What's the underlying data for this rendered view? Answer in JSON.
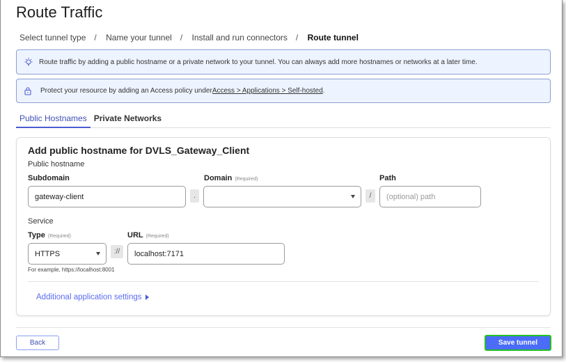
{
  "page": {
    "title": "Route Traffic"
  },
  "breadcrumb": [
    "Select tunnel type",
    "Name your tunnel",
    "Install and run connectors",
    "Route tunnel"
  ],
  "notices": {
    "tip": {
      "icon": "lightbulb-icon",
      "text": "Route traffic by adding a public hostname or a private network to your tunnel. You can always add more hostnames or networks at a later time."
    },
    "access": {
      "icon": "lock-icon",
      "text": "Protect your resource by adding an Access policy under ",
      "link": "Access > Applications > Self-hosted",
      "suffix": "."
    }
  },
  "tabs": [
    {
      "label": "Public Hostnames",
      "active": true
    },
    {
      "label": "Private Networks",
      "active": false
    }
  ],
  "form": {
    "title": "Add public hostname for DVLS_Gateway_Client",
    "public_hostname_label": "Public hostname",
    "subdomain": {
      "label": "Subdomain",
      "value": "gateway-client"
    },
    "dot": ".",
    "domain": {
      "label": "Domain",
      "required": "(Required)",
      "value": ""
    },
    "slash": "/",
    "path": {
      "label": "Path",
      "placeholder": "(optional) path"
    },
    "service_label": "Service",
    "type": {
      "label": "Type",
      "required": "(Required)",
      "value": "HTTPS"
    },
    "scheme_sep": "://",
    "url": {
      "label": "URL",
      "required": "(Required)",
      "value": "localhost:7171"
    },
    "example": "For example, https://localhost:8001",
    "additional": "Additional application settings"
  },
  "footer": {
    "back": "Back",
    "save": "Save tunnel"
  },
  "colors": {
    "accent": "#4a6cf7",
    "tab_active": "#4a5bd0",
    "highlight": "#22c022",
    "notice_bg": "#eef4ff"
  }
}
